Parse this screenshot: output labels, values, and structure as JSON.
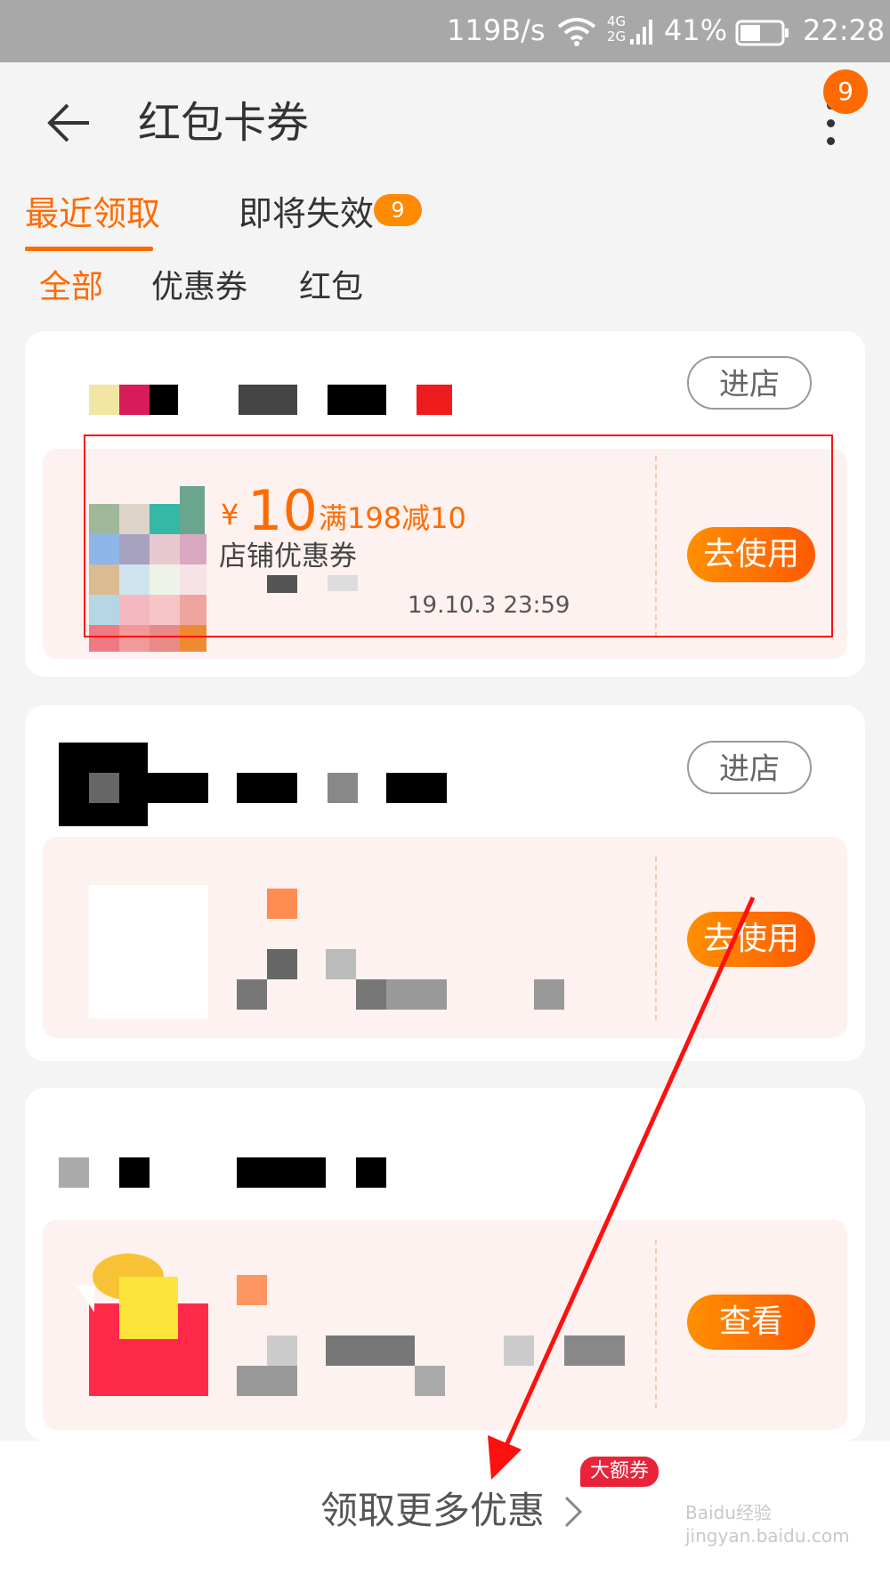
{
  "status_bar": {
    "net_speed": "119B/s",
    "network": "4G 2G",
    "battery": "41%",
    "time": "22:28"
  },
  "header": {
    "title": "红包卡券",
    "more_badge": "9"
  },
  "tabs": [
    {
      "label": "最近领取"
    },
    {
      "label": "即将失效",
      "badge": "9"
    }
  ],
  "filters": [
    {
      "label": "全部"
    },
    {
      "label": "优惠券"
    },
    {
      "label": "红包"
    }
  ],
  "cards": [
    {
      "enter_label": "进店",
      "coupon": {
        "currency": "¥",
        "amount": "10",
        "condition": "满198减10",
        "type": "店铺优惠券",
        "expiry": "19.10.3 23:59",
        "action": "去使用"
      }
    },
    {
      "enter_label": "进店",
      "coupon": {
        "action": "去使用"
      }
    },
    {
      "coupon": {
        "action": "查看"
      }
    }
  ],
  "bottom": {
    "more_label": "领取更多优惠",
    "badge": "大额券"
  },
  "watermark": "Baidu经验 jingyan.baidu.com",
  "colors": {
    "accent": "#ff6a00",
    "annotation": "#ff1010",
    "badge_red": "#e8233a"
  }
}
